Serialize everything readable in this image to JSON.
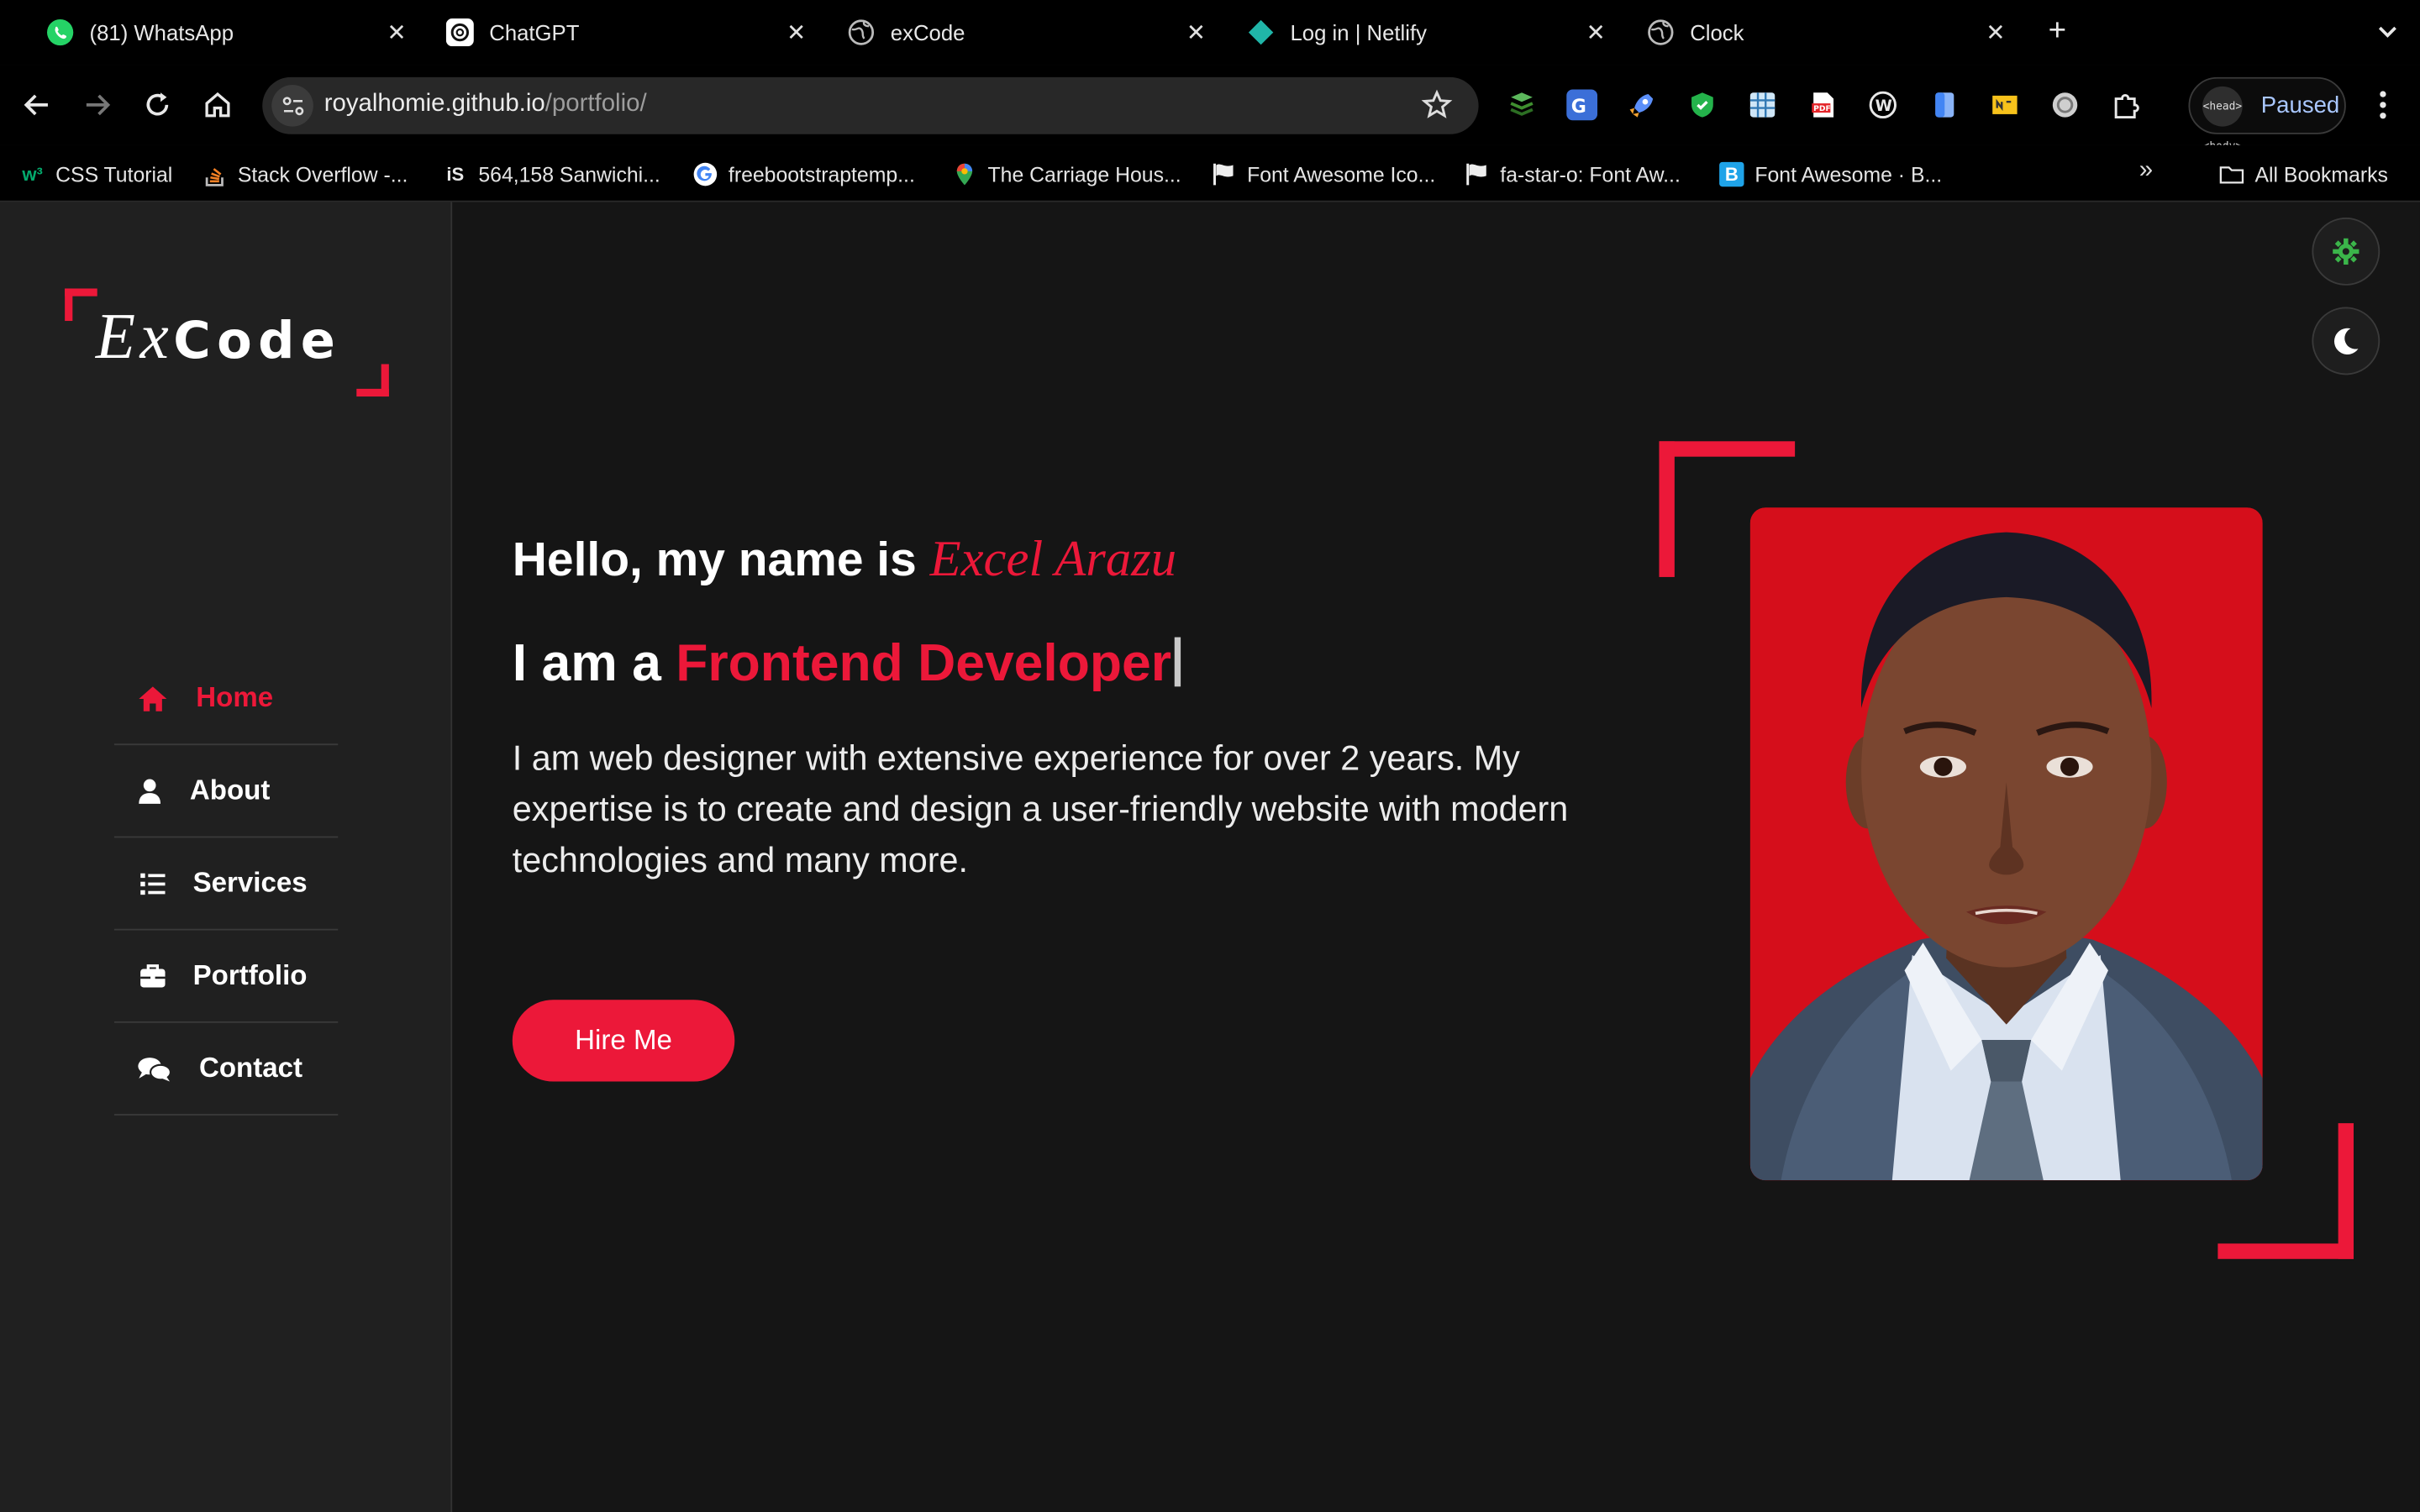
{
  "browser": {
    "tabs": [
      {
        "title": "(81) WhatsApp",
        "icon": "whatsapp-icon"
      },
      {
        "title": "ChatGPT",
        "icon": "chatgpt-icon"
      },
      {
        "title": "exCode",
        "icon": "globe-icon"
      },
      {
        "title": "Log in | Netlify",
        "icon": "netlify-icon"
      },
      {
        "title": "Clock",
        "icon": "globe-icon"
      }
    ],
    "url_host": "royalhomie.github.io",
    "url_path": "/portfolio/",
    "profile_label": "Paused",
    "profile_avatar_text": "<head> <body>",
    "bookmarks": [
      {
        "label": "CSS Tutorial",
        "icon": "w3schools-icon"
      },
      {
        "label": "Stack Overflow -...",
        "icon": "stackoverflow-icon"
      },
      {
        "label": "564,158 Sanwichi...",
        "icon": "istock-icon"
      },
      {
        "label": "freebootstraptemp...",
        "icon": "google-icon"
      },
      {
        "label": "The Carriage Hous...",
        "icon": "maps-pin-icon"
      },
      {
        "label": "Font Awesome Ico...",
        "icon": "flag-icon"
      },
      {
        "label": "fa-star-o: Font Aw...",
        "icon": "flag-icon"
      },
      {
        "label": "Font Awesome · B...",
        "icon": "bootstrap-icon"
      }
    ],
    "all_bookmarks_label": "All Bookmarks"
  },
  "site": {
    "logo_ex": "Ex",
    "logo_code": "Code",
    "nav": [
      {
        "label": "Home",
        "icon": "home-icon",
        "active": true
      },
      {
        "label": "About",
        "icon": "user-icon",
        "active": false
      },
      {
        "label": "Services",
        "icon": "list-icon",
        "active": false
      },
      {
        "label": "Portfolio",
        "icon": "briefcase-icon",
        "active": false
      },
      {
        "label": "Contact",
        "icon": "comments-icon",
        "active": false
      }
    ],
    "hello_prefix": "Hello, my name is ",
    "name": "Excel Arazu",
    "iam_prefix": "I am a ",
    "role": "Frontend Developer",
    "description": "I am web designer with extensive experience for over 2 years. My expertise is to create and design a user-friendly website with modern technologies and many more.",
    "hire_label": "Hire Me"
  },
  "colors": {
    "accent": "#ec1839",
    "page_bg": "#151515",
    "sidebar_bg": "#202020",
    "photo_bg": "#d50e1b"
  }
}
